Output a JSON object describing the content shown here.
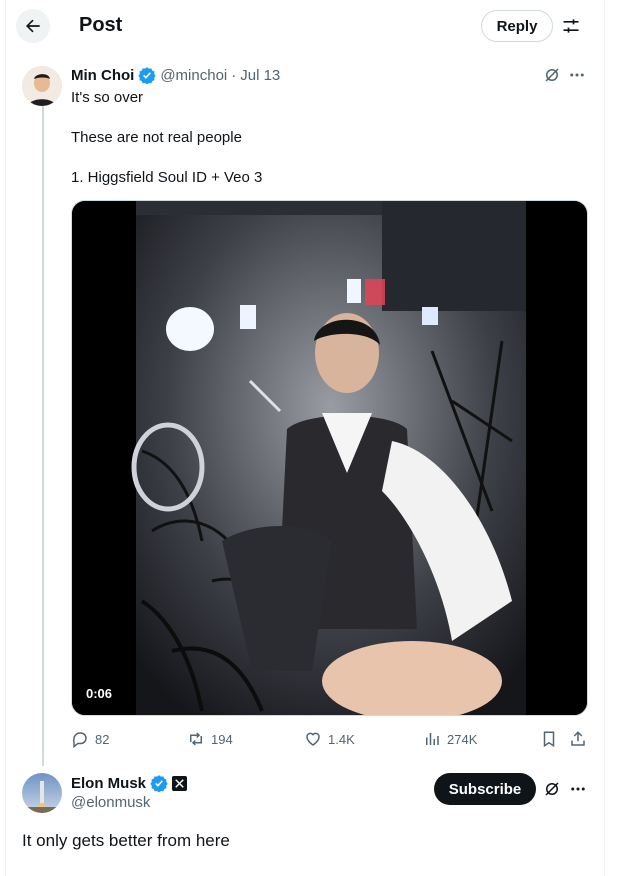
{
  "header": {
    "title": "Post",
    "reply_label": "Reply"
  },
  "original_post": {
    "author_name": "Min Choi",
    "handle": "@minchoi",
    "separator": "·",
    "date": "Jul 13",
    "lines": [
      "It's so over",
      "These are not real people",
      "1. Higgsfield Soul ID + Veo 3"
    ],
    "video_time": "0:06",
    "stats": {
      "replies": "82",
      "reposts": "194",
      "likes": "1.4K",
      "views": "274K"
    }
  },
  "reply_post": {
    "author_name": "Elon Musk",
    "handle": "@elonmusk",
    "subscribe_label": "Subscribe",
    "text": "It only gets better from here"
  },
  "colors": {
    "verified": "#1d9bf0",
    "text": "#0f1419",
    "muted": "#536471",
    "border": "#cfd9de"
  }
}
